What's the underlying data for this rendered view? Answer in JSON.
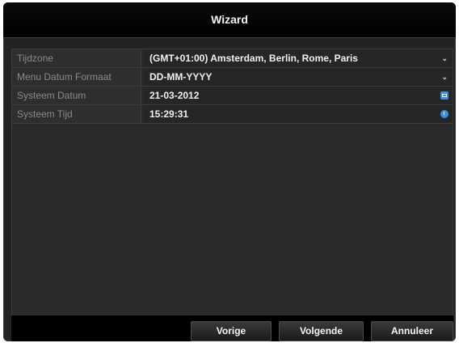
{
  "window": {
    "title": "Wizard"
  },
  "settings": {
    "rows": [
      {
        "label": "Tijdzone",
        "value": "(GMT+01:00) Amsterdam, Berlin, Rome, Paris",
        "control": "dropdown"
      },
      {
        "label": "Menu Datum Formaat",
        "value": "DD-MM-YYYY",
        "control": "dropdown"
      },
      {
        "label": "Systeem Datum",
        "value": "21-03-2012",
        "control": "calendar-icon"
      },
      {
        "label": "Systeem Tijd",
        "value": "15:29:31",
        "control": "clock-icon"
      }
    ],
    "dropdown_glyph": "⌄"
  },
  "buttons": {
    "previous": "Vorige",
    "next": "Volgende",
    "cancel": "Annuleer"
  },
  "colors": {
    "accent": "#3b8fe0"
  }
}
